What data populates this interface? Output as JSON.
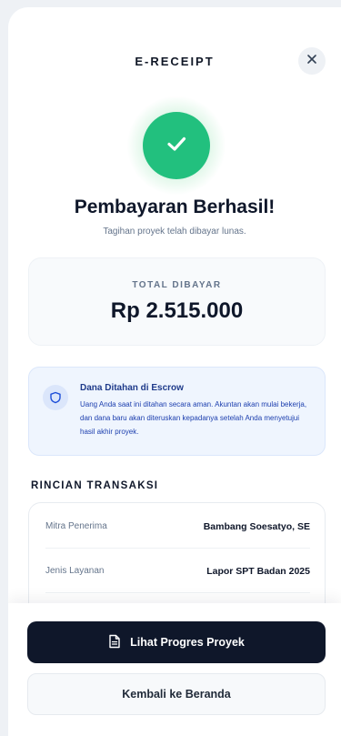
{
  "header": {
    "title": "E-RECEIPT",
    "close_icon": "close-icon"
  },
  "status": {
    "icon": "check-icon",
    "title": "Pembayaran Berhasil!",
    "subtitle": "Tagihan proyek telah dibayar lunas."
  },
  "total": {
    "label": "TOTAL DIBAYAR",
    "amount": "Rp 2.515.000"
  },
  "escrow": {
    "icon": "shield-icon",
    "title": "Dana Ditahan di Escrow",
    "text": "Uang Anda saat ini ditahan secara aman. Akuntan akan mulai bekerja, dan dana baru akan diteruskan kepadanya setelah Anda menyetujui hasil akhir proyek."
  },
  "details": {
    "section_title": "RINCIAN TRANSAKSI",
    "rows": [
      {
        "label": "Mitra Penerima",
        "value": "Bambang Soesatyo, SE"
      },
      {
        "label": "Jenis Layanan",
        "value": "Lapor SPT Badan 2025"
      }
    ]
  },
  "actions": {
    "primary_icon": "document-icon",
    "primary_label": "Lihat Progres Proyek",
    "secondary_label": "Kembali ke Beranda"
  },
  "colors": {
    "success": "#22c07e",
    "primary_button": "#0f172a",
    "escrow_bg": "#eff5fe",
    "escrow_text": "#1e40af"
  }
}
